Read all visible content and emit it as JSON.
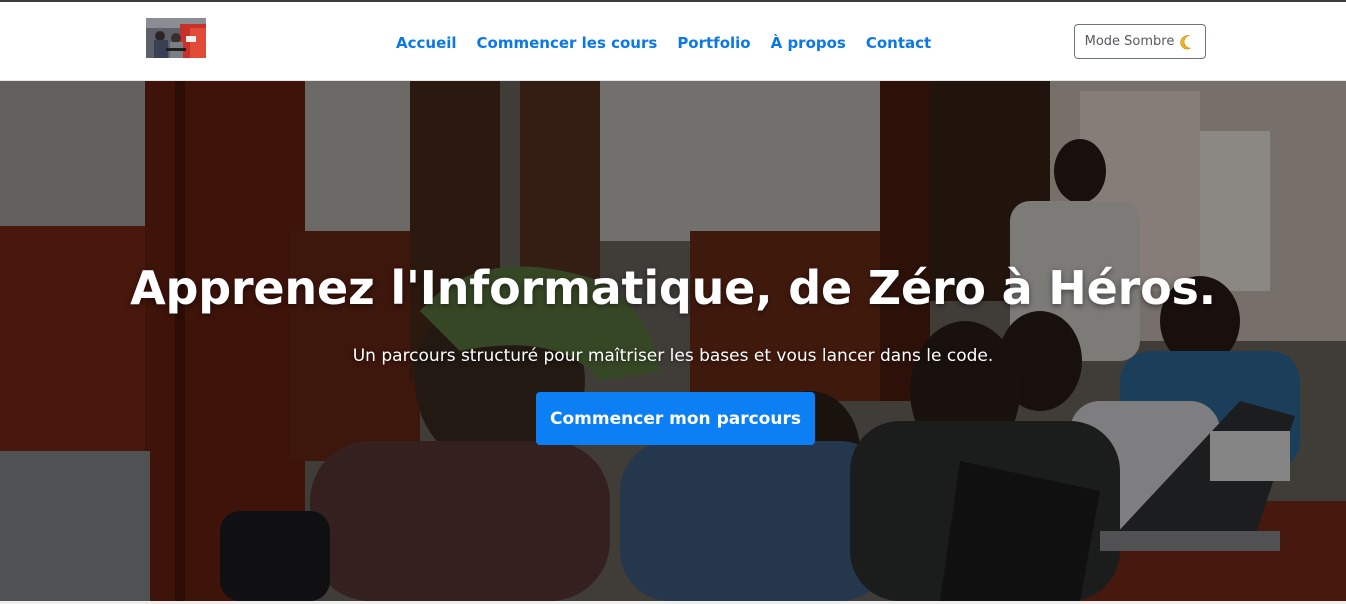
{
  "header": {
    "logo_icon": "site-logo-photo",
    "nav": [
      {
        "label": "Accueil"
      },
      {
        "label": "Commencer les cours"
      },
      {
        "label": "Portfolio"
      },
      {
        "label": "À propos"
      },
      {
        "label": "Contact"
      }
    ],
    "mode_toggle": {
      "label": "Mode Sombre",
      "icon": "moon-icon"
    }
  },
  "hero": {
    "title": "Apprenez l'Informatique, de Zéro à Héros.",
    "subtitle": "Un parcours structuré pour maîtriser les bases et vous lancer dans le code.",
    "cta_label": "Commencer mon parcours",
    "background": "photo-students-with-laptops"
  },
  "colors": {
    "accent": "#0d7ff5",
    "nav_link": "#0a78e6",
    "button_border": "#6c757d"
  }
}
